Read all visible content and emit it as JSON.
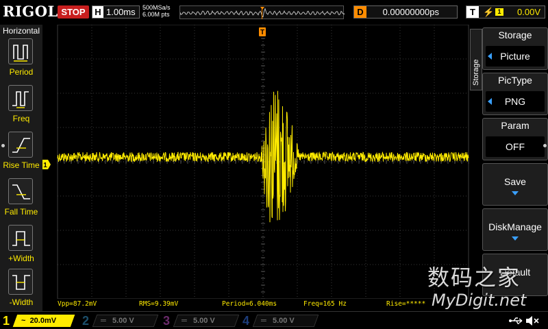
{
  "brand": {
    "logo": "RIGOL"
  },
  "status": {
    "run_state": "STOP"
  },
  "horizontal": {
    "label": "H",
    "timebase": "1.00ms",
    "sample_rate": "500MSa/s",
    "mem_depth": "6.00M pts"
  },
  "delay": {
    "label": "D",
    "value": "0.00000000ps"
  },
  "trigger": {
    "label": "T",
    "channel": "1",
    "level": "0.00V",
    "marker": "T"
  },
  "left_menu": {
    "title": "Horizontal",
    "items": [
      {
        "label": "Period",
        "icon": "period-icon"
      },
      {
        "label": "Freq",
        "icon": "freq-icon"
      },
      {
        "label": "Rise Time",
        "icon": "rise-time-icon"
      },
      {
        "label": "Fall Time",
        "icon": "fall-time-icon"
      },
      {
        "label": "+Width",
        "icon": "pos-width-icon"
      },
      {
        "label": "-Width",
        "icon": "neg-width-icon"
      }
    ]
  },
  "right_menu": {
    "side_label": "Storage",
    "storage": {
      "title": "Storage",
      "value": "Picture"
    },
    "pictype": {
      "title": "PicType",
      "value": "PNG"
    },
    "param": {
      "title": "Param",
      "value": "OFF"
    },
    "save": {
      "title": "Save"
    },
    "disk": {
      "title": "DiskManage"
    },
    "default": {
      "title": "Default"
    }
  },
  "channel_marker": "1",
  "measurements": {
    "vpp": "Vpp=87.2mV",
    "rms": "RMS=9.39mV",
    "period": "Period=6.040ms",
    "freq": "Freq=165 Hz",
    "rise": "Rise=*****"
  },
  "channels": [
    {
      "num": "1",
      "coupling": "~",
      "scale": "20.0mV",
      "color": "#ffeb00"
    },
    {
      "num": "2",
      "coupling": "═",
      "scale": "5.00 V",
      "color": "#1c4f6b"
    },
    {
      "num": "3",
      "coupling": "═",
      "scale": "5.00 V",
      "color": "#6a2a6a"
    },
    {
      "num": "4",
      "coupling": "═",
      "scale": "5.00 V",
      "color": "#1c3c7a"
    }
  ],
  "watermark": {
    "cn": "数码之家",
    "en": "MyDigit.net"
  },
  "colors": {
    "ch1": "#ffeb00",
    "trigger": "#ff8c00",
    "stop": "#c81e1e",
    "grid": "#3a3a3a"
  }
}
